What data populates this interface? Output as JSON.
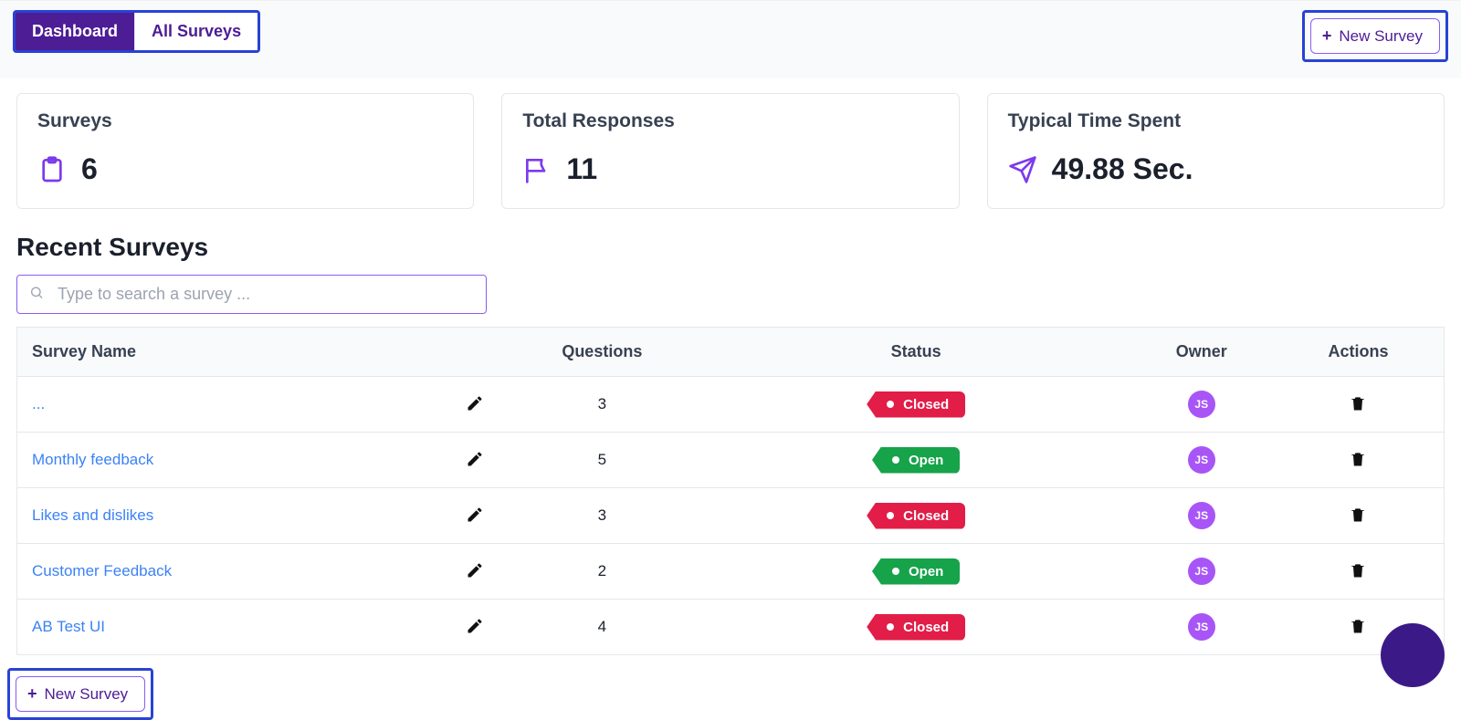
{
  "tabs": {
    "dashboard": "Dashboard",
    "all": "All Surveys"
  },
  "buttons": {
    "new_survey": "New Survey"
  },
  "cards": {
    "surveys": {
      "title": "Surveys",
      "value": "6"
    },
    "responses": {
      "title": "Total Responses",
      "value": "11"
    },
    "time": {
      "title": "Typical Time Spent",
      "value": "49.88 Sec."
    }
  },
  "section_title": "Recent Surveys",
  "search": {
    "placeholder": "Type to search a survey ..."
  },
  "table": {
    "headers": {
      "name": "Survey Name",
      "questions": "Questions",
      "status": "Status",
      "owner": "Owner",
      "actions": "Actions"
    },
    "rows": [
      {
        "name": "...",
        "questions": "3",
        "status": "Closed",
        "status_kind": "closed",
        "owner": "JS"
      },
      {
        "name": "Monthly feedback",
        "questions": "5",
        "status": "Open",
        "status_kind": "open",
        "owner": "JS"
      },
      {
        "name": "Likes and dislikes",
        "questions": "3",
        "status": "Closed",
        "status_kind": "closed",
        "owner": "JS"
      },
      {
        "name": "Customer Feedback",
        "questions": "2",
        "status": "Open",
        "status_kind": "open",
        "owner": "JS"
      },
      {
        "name": "AB Test UI",
        "questions": "4",
        "status": "Closed",
        "status_kind": "closed",
        "owner": "JS"
      }
    ]
  }
}
